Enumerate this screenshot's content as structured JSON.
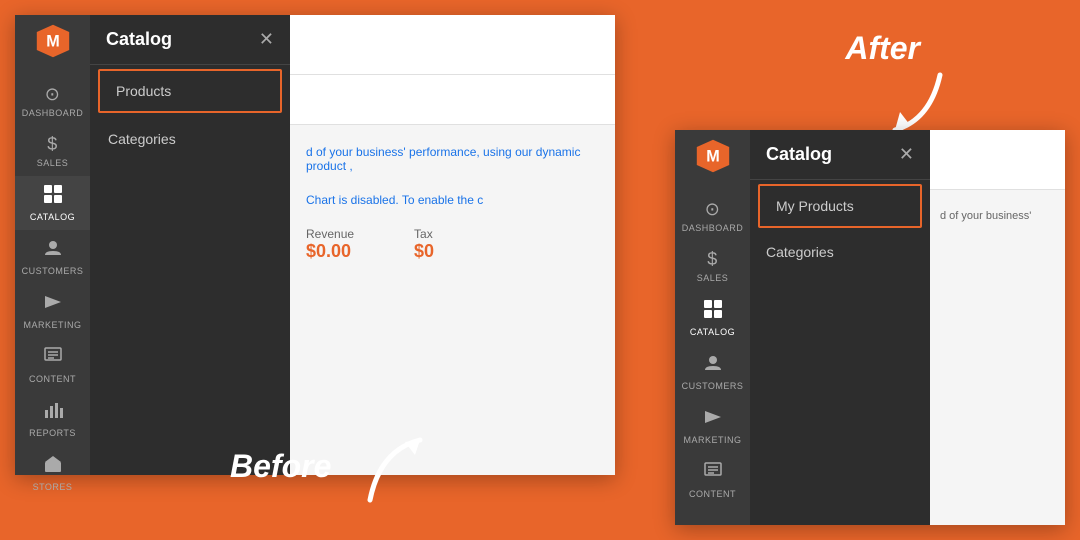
{
  "label_before": "Before",
  "label_after": "After",
  "before": {
    "sidebar": {
      "logo_symbol": "M",
      "items": [
        {
          "id": "dashboard",
          "label": "DASHBOARD",
          "icon": "⊙"
        },
        {
          "id": "sales",
          "label": "SALES",
          "icon": "$"
        },
        {
          "id": "catalog",
          "label": "CATALOG",
          "icon": "◧",
          "active": true
        },
        {
          "id": "customers",
          "label": "CUSTOMERS",
          "icon": "👤"
        },
        {
          "id": "marketing",
          "label": "MARKETING",
          "icon": "📢"
        },
        {
          "id": "content",
          "label": "CONTENT",
          "icon": "▦"
        },
        {
          "id": "reports",
          "label": "REPORTS",
          "icon": "📊"
        },
        {
          "id": "stores",
          "label": "STORES",
          "icon": "🏪"
        }
      ]
    },
    "catalog_panel": {
      "title": "Catalog",
      "close_label": "✕",
      "menu_items": [
        {
          "id": "products",
          "label": "Products",
          "selected": true
        },
        {
          "id": "categories",
          "label": "Categories"
        }
      ]
    },
    "main": {
      "text_partial": "d of your business' performance, using our",
      "link_text": "dynamic product",
      "chart_disabled": "Chart is disabled. To enable the c",
      "revenue_label": "Revenue",
      "revenue_amount": "$0.00",
      "tax_label": "Tax",
      "tax_amount": "$0"
    }
  },
  "after": {
    "sidebar": {
      "logo_symbol": "M",
      "items": [
        {
          "id": "dashboard",
          "label": "DASHBOARD",
          "icon": "⊙"
        },
        {
          "id": "sales",
          "label": "SALES",
          "icon": "$"
        },
        {
          "id": "catalog",
          "label": "CATALOG",
          "icon": "◧",
          "active": true
        },
        {
          "id": "customers",
          "label": "CUSTOMERS",
          "icon": "👤"
        },
        {
          "id": "marketing",
          "label": "MARKETING",
          "icon": "📢"
        },
        {
          "id": "content",
          "label": "CONTENT",
          "icon": "▦"
        }
      ]
    },
    "catalog_panel": {
      "title": "Catalog",
      "close_label": "✕",
      "menu_items": [
        {
          "id": "my-products",
          "label": "My Products",
          "selected": true
        },
        {
          "id": "categories",
          "label": "Categories"
        }
      ]
    },
    "main": {
      "text_partial": "d of your business'"
    }
  }
}
